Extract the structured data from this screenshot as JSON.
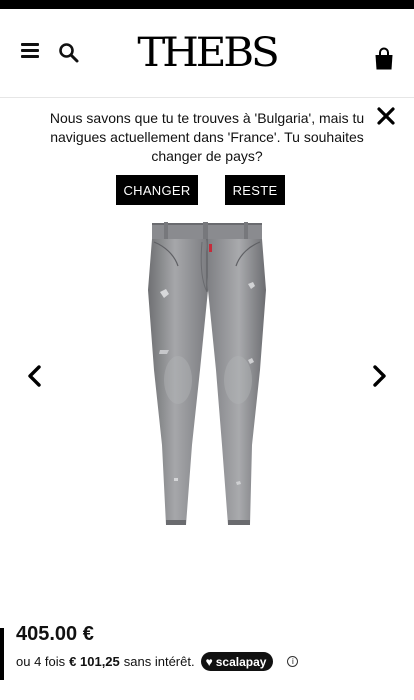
{
  "header": {
    "logo_text": "THEBS"
  },
  "banner": {
    "message": "Nous savons que tu te trouves à 'Bulgaria', mais tu navigues actuellement dans 'France'. Tu souhaites changer de pays?",
    "change_label": "CHANGER",
    "stay_label": "RESTE"
  },
  "product": {
    "price": "405.00 €",
    "installment_prefix": "ou 4 fois",
    "installment_amount": "€ 101,25",
    "installment_suffix": "sans intérêt.",
    "scalapay_label": "scalapay",
    "info_glyph": "i"
  },
  "icons": {
    "menu": "hamburger-menu-icon",
    "search": "search-icon",
    "cart": "shopping-bag-icon",
    "close": "close-icon",
    "prev": "chevron-left-icon",
    "next": "chevron-right-icon"
  },
  "colors": {
    "primary": "#000000",
    "background": "#ffffff",
    "denim": "#8e8f92"
  }
}
